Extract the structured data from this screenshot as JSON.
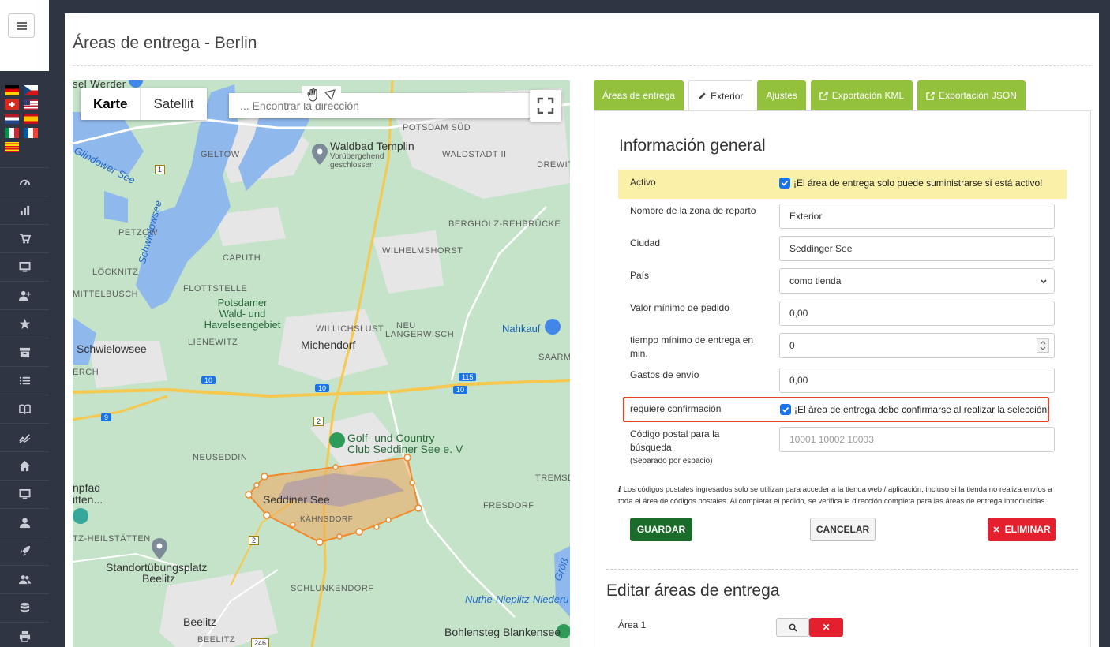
{
  "sidebar": {
    "menu_icon": "hamburger-icon",
    "flags": [
      "de",
      "cz",
      "ch",
      "us",
      "nl",
      "es",
      "it",
      "fr",
      "ca"
    ],
    "items": [
      {
        "icon": "dashboard-icon"
      },
      {
        "icon": "bar-chart-icon"
      },
      {
        "icon": "cart-icon"
      },
      {
        "icon": "monitor-icon"
      },
      {
        "icon": "add-user-icon"
      },
      {
        "icon": "star-icon"
      },
      {
        "icon": "archive-icon"
      },
      {
        "icon": "list-icon"
      },
      {
        "icon": "book-icon"
      },
      {
        "icon": "line-chart-icon"
      },
      {
        "icon": "home-icon"
      },
      {
        "icon": "desktop-icon"
      },
      {
        "icon": "user-icon"
      },
      {
        "icon": "rocket-icon"
      },
      {
        "icon": "users-icon"
      },
      {
        "icon": "database-icon"
      },
      {
        "icon": "print-icon"
      }
    ]
  },
  "page": {
    "title": "Áreas de entrega  - Berlin"
  },
  "map": {
    "type_map": "Karte",
    "type_satellite": "Satellit",
    "search_placeholder": "... Encontrar la dirección",
    "labels": {
      "werder": "sel Werder",
      "potsdam_sud": "POTSDAM SÜD",
      "geltow": "GELTOW",
      "waldbad": "Waldbad Templin",
      "waldbad_sub1": "Vorübergehend",
      "waldbad_sub2": "geschlossen",
      "waldstadt": "WALDSTADT II",
      "drewitz": "DREWITZ",
      "glindower": "Glindower See",
      "bergholz": "BERGHOLZ-REHBRÜCKE",
      "petzow": "PETZOW",
      "caputh": "CAPUTH",
      "wilhelmshorst": "WILHELMSHORST",
      "locknitz": "LÖCKNITZ",
      "flottstelle": "FLOTTSTELLE",
      "schwielowsee_lake": "Schwielowsee",
      "mittelbusch": "MITTELBUSCH",
      "potsdamer1": "Potsdamer",
      "potsdamer2": "Wald- und",
      "potsdamer3": "Havelseengebiet",
      "willichslust": "WILLICHSLUST",
      "neu_langerwisch1": "NEU",
      "neu_langerwisch2": "LANGERWISCH",
      "nahkauf": "Nahkauf",
      "lienewitz": "LIENEWITZ",
      "schwielowsee_town": "Schwielowsee",
      "michendorf": "Michendorf",
      "ferch": "ERCH",
      "saarmund": "SAARMUND",
      "golf1": "Golf- und Country",
      "golf2": "Club Seddiner See e. V",
      "neuseddin": "NEUSEDDIN",
      "tremsdorf": "TREMSDORF",
      "pfad1": "npfad",
      "pfad2": "itten...",
      "seddiner": "Seddiner See",
      "fresdorf": "FRESDORF",
      "kahnsdorf": "KÄHNSDORF",
      "heilstatten": "TZ-HEILSTÄTTEN",
      "standort1": "Standortübungsplatz",
      "standort2": "Beelitz",
      "schlunkendorf": "SCHLUNKENDORF",
      "nuthe": "Nuthe-Nieplitz-Niederu",
      "beelitz": "Beelitz",
      "bohlensteg": "Bohlensteg Blankensee",
      "beelitz_small": "BEELITZ",
      "gross": "Größ"
    },
    "roads": [
      "1",
      "10",
      "10",
      "10",
      "115",
      "2",
      "2",
      "9",
      "246"
    ]
  },
  "tabs": [
    {
      "label": "Áreas de entrega",
      "icon": ""
    },
    {
      "label": "Exterior",
      "icon": "pencil-icon"
    },
    {
      "label": "Ajustes",
      "icon": ""
    },
    {
      "label": "Exportación KML",
      "icon": "export-icon"
    },
    {
      "label": "Exportación JSON",
      "icon": "export-icon"
    }
  ],
  "form": {
    "title": "Información general",
    "active_label": "Activo",
    "active_checked": true,
    "active_text": "¡El área de entrega solo puede suministrarse si está activo!",
    "name_label": "Nombre de la zona de reparto",
    "name_value": "Exterior",
    "city_label": "Ciudad",
    "city_value": "Seddinger See",
    "country_label": "País",
    "country_value": "como tienda",
    "min_order_label": "Valor mínimo de pedido",
    "min_order_value": "0,00",
    "min_time_label_1": "tiempo mínimo de entrega en",
    "min_time_label_2": "min.",
    "min_time_value": "0",
    "shipping_label": "Gastos de envío",
    "shipping_value": "0,00",
    "confirm_label": "requiere confirmación",
    "confirm_checked": true,
    "confirm_text": "¡El área de entrega debe confirmarse al realizar la selección!",
    "postal_label_1": "Código postal para la",
    "postal_label_2": "búsqueda",
    "postal_note": "(Separado por espacio)",
    "postal_placeholder": "10001 10002 10003",
    "hint_line1": "Los códigos postales ingresados solo se utilizan para acceder a la tienda web / aplicación, incluso si la tienda no realiza envíos a",
    "hint_line2": "toda el área de códigos postales. Al completar el pedido, se verifica la dirección completa para las áreas de entrega introducidas.",
    "save_label": "GUARDAR",
    "cancel_label": "CANCELAR",
    "delete_label": "ELIMINAR"
  },
  "edit": {
    "title": "Editar áreas de entrega",
    "area_label": "Área 1"
  },
  "colors": {
    "sidebar": "#2f3542",
    "tab_green": "#93c13c",
    "save_green": "#1b6b2a",
    "delete_red": "#e5202e",
    "highlight_yellow": "#faf0a8",
    "confirm_border": "#e0442a",
    "checkbox_blue": "#1a73e8",
    "polygon": "#f3a85b"
  }
}
